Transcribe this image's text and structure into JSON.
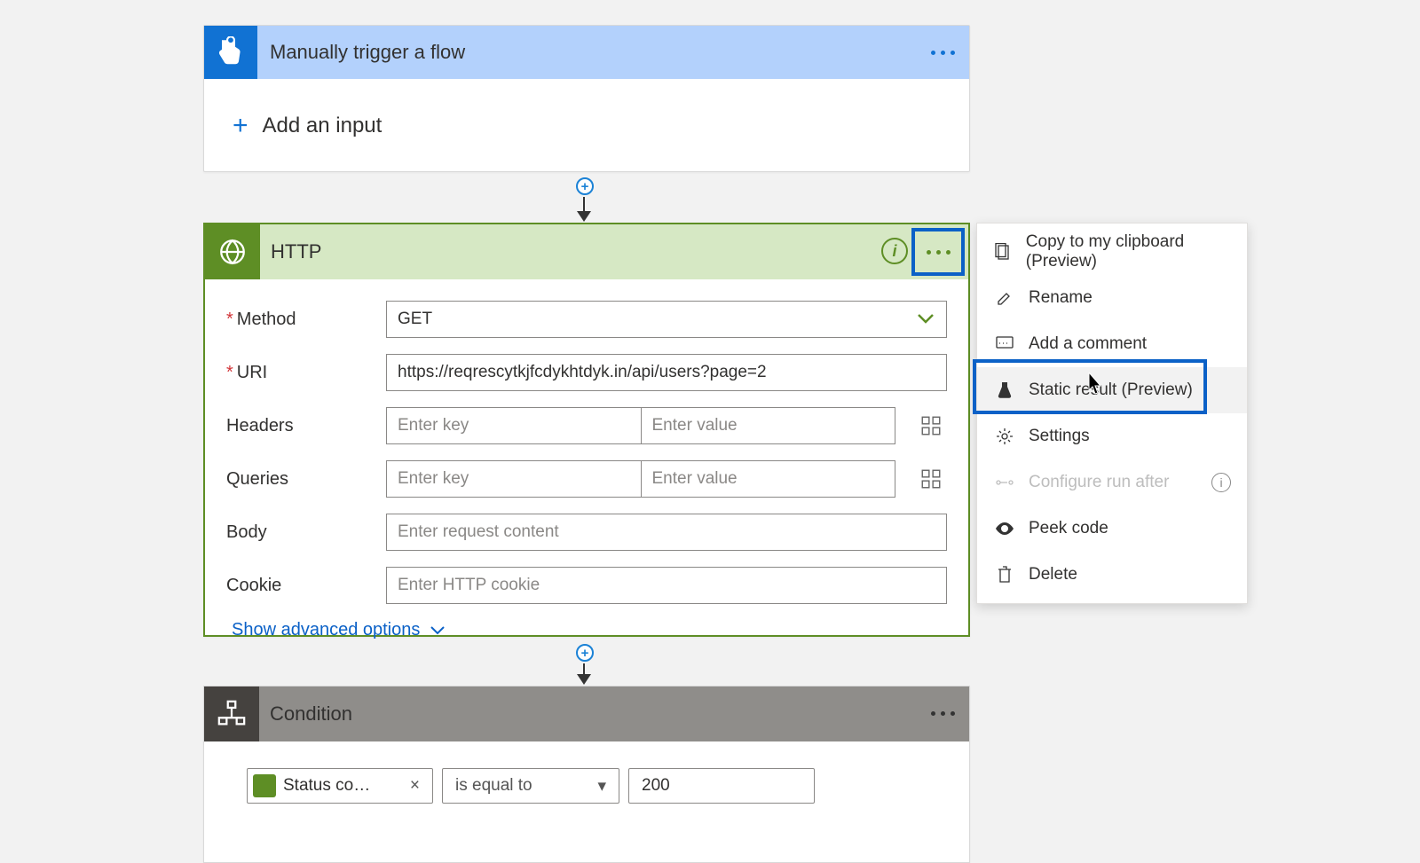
{
  "trigger": {
    "title": "Manually trigger a flow",
    "add_input": "Add an input"
  },
  "http": {
    "title": "HTTP",
    "fields": {
      "method_label": "Method",
      "method_value": "GET",
      "uri_label": "URI",
      "uri_value": "https://reqrescytkjfcdykhtdyk.in/api/users?page=2",
      "headers_label": "Headers",
      "headers_key_ph": "Enter key",
      "headers_val_ph": "Enter value",
      "queries_label": "Queries",
      "queries_key_ph": "Enter key",
      "queries_val_ph": "Enter value",
      "body_label": "Body",
      "body_ph": "Enter request content",
      "cookie_label": "Cookie",
      "cookie_ph": "Enter HTTP cookie"
    },
    "show_advanced": "Show advanced options"
  },
  "condition": {
    "title": "Condition",
    "left_pill": "Status co…",
    "op_pill": "is equal to",
    "val_pill": "200"
  },
  "menu": {
    "copy": "Copy to my clipboard (Preview)",
    "rename": "Rename",
    "add_comment": "Add a comment",
    "static_result": "Static result (Preview)",
    "settings": "Settings",
    "configure_run_after": "Configure run after",
    "peek_code": "Peek code",
    "delete": "Delete"
  }
}
